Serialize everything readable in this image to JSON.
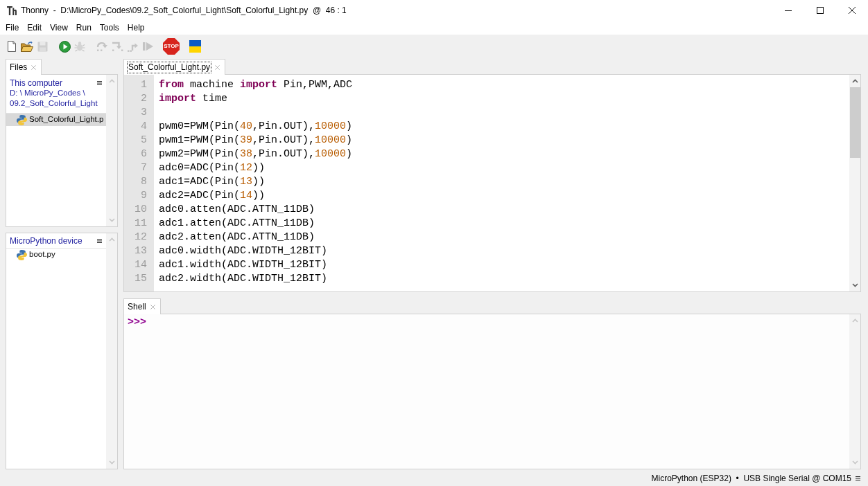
{
  "window": {
    "title": "Thonny  -  D:\\MicroPy_Codes\\09.2_Soft_Colorful_Light\\Soft_Colorful_Light.py  @  46 : 1"
  },
  "menu": [
    "File",
    "Edit",
    "View",
    "Run",
    "Tools",
    "Help"
  ],
  "toolbar": {
    "groups": [
      {
        "buttons": [
          {
            "kind": "new",
            "disabled": false
          },
          {
            "kind": "open",
            "disabled": false
          },
          {
            "kind": "save",
            "disabled": true
          }
        ]
      },
      {
        "buttons": [
          {
            "kind": "run",
            "disabled": false
          },
          {
            "kind": "debug",
            "disabled": true
          }
        ]
      },
      {
        "buttons": [
          {
            "kind": "step_over",
            "disabled": true
          },
          {
            "kind": "step_into",
            "disabled": true
          },
          {
            "kind": "step_out",
            "disabled": true
          },
          {
            "kind": "resume",
            "disabled": true
          }
        ]
      },
      {
        "buttons": [
          {
            "kind": "stop",
            "disabled": false,
            "label": "STOP"
          }
        ]
      },
      {
        "buttons": [
          {
            "kind": "support",
            "disabled": false
          }
        ]
      }
    ]
  },
  "files_panel": {
    "tabs": [
      {
        "label": "Files",
        "selected": true
      }
    ],
    "sections": [
      {
        "title": "This computer",
        "path": "D: \\ MicroPy_Codes \\ 09.2_Soft_Colorful_Light",
        "items": [
          {
            "name": "Soft_Colorful_Light.p",
            "selected": true
          }
        ]
      },
      {
        "title": "MicroPython device",
        "items": [
          {
            "name": "boot.py",
            "selected": false
          }
        ]
      }
    ]
  },
  "editor": {
    "tabs": [
      {
        "label": "Soft_Colorful_Light.py",
        "selected": true,
        "focused": true
      }
    ],
    "lines": [
      {
        "number": "1",
        "tokens": [
          {
            "kind": "keyword",
            "text": "from"
          },
          {
            "kind": "plain",
            "text": " machine "
          },
          {
            "kind": "keyword",
            "text": "import"
          },
          {
            "kind": "plain",
            "text": " Pin,PWM,ADC"
          }
        ]
      },
      {
        "number": "2",
        "tokens": [
          {
            "kind": "keyword",
            "text": "import"
          },
          {
            "kind": "plain",
            "text": " time"
          }
        ]
      },
      {
        "number": "3"
      },
      {
        "number": "4",
        "tokens": [
          {
            "kind": "plain",
            "text": "pwm0=PWM(Pin("
          },
          {
            "kind": "number",
            "text": "40"
          },
          {
            "kind": "plain",
            "text": ",Pin.OUT),"
          },
          {
            "kind": "number",
            "text": "10000"
          },
          {
            "kind": "plain",
            "text": ")"
          }
        ]
      },
      {
        "number": "5",
        "tokens": [
          {
            "kind": "plain",
            "text": "pwm1=PWM(Pin("
          },
          {
            "kind": "number",
            "text": "39"
          },
          {
            "kind": "plain",
            "text": ",Pin.OUT),"
          },
          {
            "kind": "number",
            "text": "10000"
          },
          {
            "kind": "plain",
            "text": ")"
          }
        ]
      },
      {
        "number": "6",
        "tokens": [
          {
            "kind": "plain",
            "text": "pwm2=PWM(Pin("
          },
          {
            "kind": "number",
            "text": "38"
          },
          {
            "kind": "plain",
            "text": ",Pin.OUT),"
          },
          {
            "kind": "number",
            "text": "10000"
          },
          {
            "kind": "plain",
            "text": ")"
          }
        ]
      },
      {
        "number": "7",
        "tokens": [
          {
            "kind": "plain",
            "text": "adc0=ADC(Pin("
          },
          {
            "kind": "number",
            "text": "12"
          },
          {
            "kind": "plain",
            "text": "))"
          }
        ]
      },
      {
        "number": "8",
        "tokens": [
          {
            "kind": "plain",
            "text": "adc1=ADC(Pin("
          },
          {
            "kind": "number",
            "text": "13"
          },
          {
            "kind": "plain",
            "text": "))"
          }
        ]
      },
      {
        "number": "9",
        "tokens": [
          {
            "kind": "plain",
            "text": "adc2=ADC(Pin("
          },
          {
            "kind": "number",
            "text": "14"
          },
          {
            "kind": "plain",
            "text": "))"
          }
        ]
      },
      {
        "number": "10",
        "tokens": [
          {
            "kind": "plain",
            "text": "adc0.atten(ADC.ATTN_11DB)"
          }
        ]
      },
      {
        "number": "11",
        "tokens": [
          {
            "kind": "plain",
            "text": "adc1.atten(ADC.ATTN_11DB)"
          }
        ]
      },
      {
        "number": "12",
        "tokens": [
          {
            "kind": "plain",
            "text": "adc2.atten(ADC.ATTN_11DB)"
          }
        ]
      },
      {
        "number": "13",
        "tokens": [
          {
            "kind": "plain",
            "text": "adc0.width(ADC.WIDTH_12BIT)"
          }
        ]
      },
      {
        "number": "14",
        "tokens": [
          {
            "kind": "plain",
            "text": "adc1.width(ADC.WIDTH_12BIT)"
          }
        ]
      },
      {
        "number": "15",
        "tokens": [
          {
            "kind": "plain",
            "text": "adc2.width(ADC.WIDTH_12BIT)"
          }
        ]
      }
    ]
  },
  "shell": {
    "tabs": [
      {
        "label": "Shell",
        "selected": true
      }
    ],
    "prompt": ">>>"
  },
  "status_bar": {
    "interpreter": "MicroPython (ESP32)  •  USB Single Serial @ COM15"
  }
}
